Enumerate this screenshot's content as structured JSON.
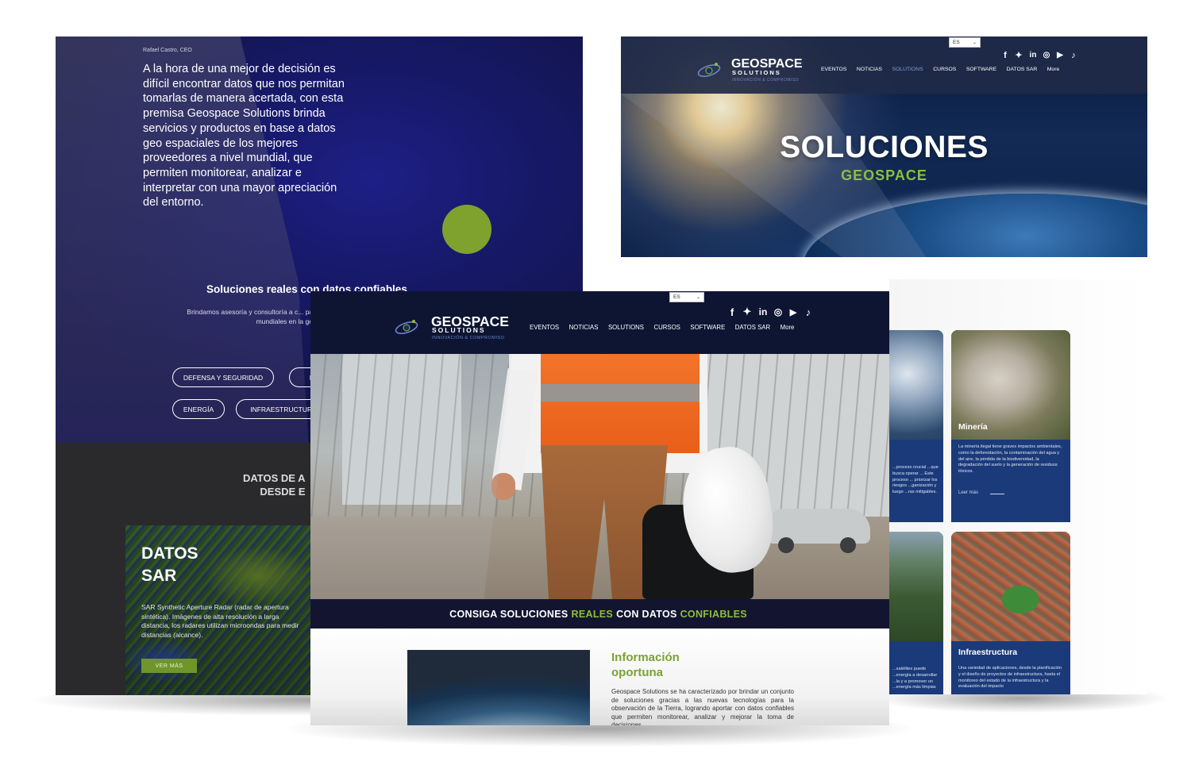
{
  "left_panel": {
    "ceo": "Rafael Castro, CEO",
    "quote": "A la hora de una mejor de decisión es  difícil encontrar datos que nos permitan tomarlas de manera acertada,  con esta premisa Geospace Solutions brinda servicios y productos en base a datos geo espaciales de los mejores proveedores a nivel mundial,  que permiten monitorear, analizar e interpretar con una mayor apreciación del entorno.",
    "solutions_title": "Soluciones reales con datos confiables",
    "solutions_desc": "Brindamos asesoría y consultoría a c... partir de datos geo espaciales. Conta... mundiales en la generación de...",
    "pills": [
      "DEFENSA Y SEGURIDAD",
      "RI",
      "ENERGÍA",
      "INFRAESTRUCTURA"
    ],
    "datos_heading_line1": "DATOS DE A",
    "datos_heading_line2": "DESDE E",
    "sar_card": {
      "title_line1": "DATOS",
      "title_line2": "SAR",
      "desc": "SAR Synthetic Aperture Radar (radar de apertura sintética). Imágenes de alta resolución a larga distancia, los radares utilizan microondas para medir distancias (alcance).",
      "button": "VER MÁS"
    }
  },
  "top_right_panel": {
    "lang": "ES",
    "logo": {
      "name": "GEOSPACE",
      "sub": "SOLUTIONS",
      "tagline": "INNOVACIÓN & COMPROMISO"
    },
    "menu": [
      "EVENTOS",
      "NOTICIAS",
      "SOLUTIONS",
      "CURSOS",
      "SOFTWARE",
      "DATOS SAR",
      "More"
    ],
    "active_menu": "SOLUTIONS",
    "hero_title": "SOLUCIONES",
    "hero_subtitle": "GEOSPACE"
  },
  "front_panel": {
    "lang": "ES",
    "logo": {
      "name": "GEOSPACE",
      "sub": "SOLUTIONS",
      "tagline": "INNOVACIÓN & COMPROMISO"
    },
    "menu": [
      "EVENTOS",
      "NOTICIAS",
      "SOLUTIONS",
      "CURSOS",
      "SOFTWARE",
      "DATOS SAR",
      "More"
    ],
    "social_icons": [
      "facebook-icon",
      "twitter-icon",
      "linkedin-icon",
      "instagram-icon",
      "youtube-icon",
      "tiktok-icon"
    ],
    "banner": {
      "part1": "CONSIGA SOLUCIONES",
      "highlight1": "REALES",
      "part2": "CON DATOS",
      "highlight2": "CONFIABLES"
    },
    "info_title_line1": "Información",
    "info_title_line2": "oportuna",
    "info_text": "Geospace Solutions se ha caracterizado por brindar un conjunto de soluciones gracias a las nuevas tecnologías para la observación de la Tierra, logrando aportar con datos confiables que permiten monitorear, analizar y mejorar la toma de decisiones..."
  },
  "right_panel": {
    "card_left_top_desc": "...proceso crucial ...que busca operar ... Este proceso ... priorizar los riesgos ...ganización y luego ...ras mitigables.",
    "card_mineria": {
      "title": "Minería",
      "desc": "La minería ilegal tiene graves impactos ambientales, como la deforestación, la contaminación del agua y del aire, la pérdida de la biodiversidad, la degradación del suelo y la generación de residuos tóxicos.",
      "link": "Leer más"
    },
    "card_left_bottom_desc": "...satélites puede ...energía a desarrollar ...la y a promover un ...energía más limpias",
    "card_infra": {
      "title": "Infraestructura",
      "desc": "Una variedad de aplicaciones, desde la planificación y el diseño de proyectos de infraestructura, hasta el monitoreo del estado de la infraestructura y la evaluación del impacto"
    }
  },
  "colors": {
    "brand_green": "#8fbf3a",
    "navy": "#0d1533",
    "card_blue": "#1b3a7a",
    "active_menu": "#7aa0d6"
  }
}
